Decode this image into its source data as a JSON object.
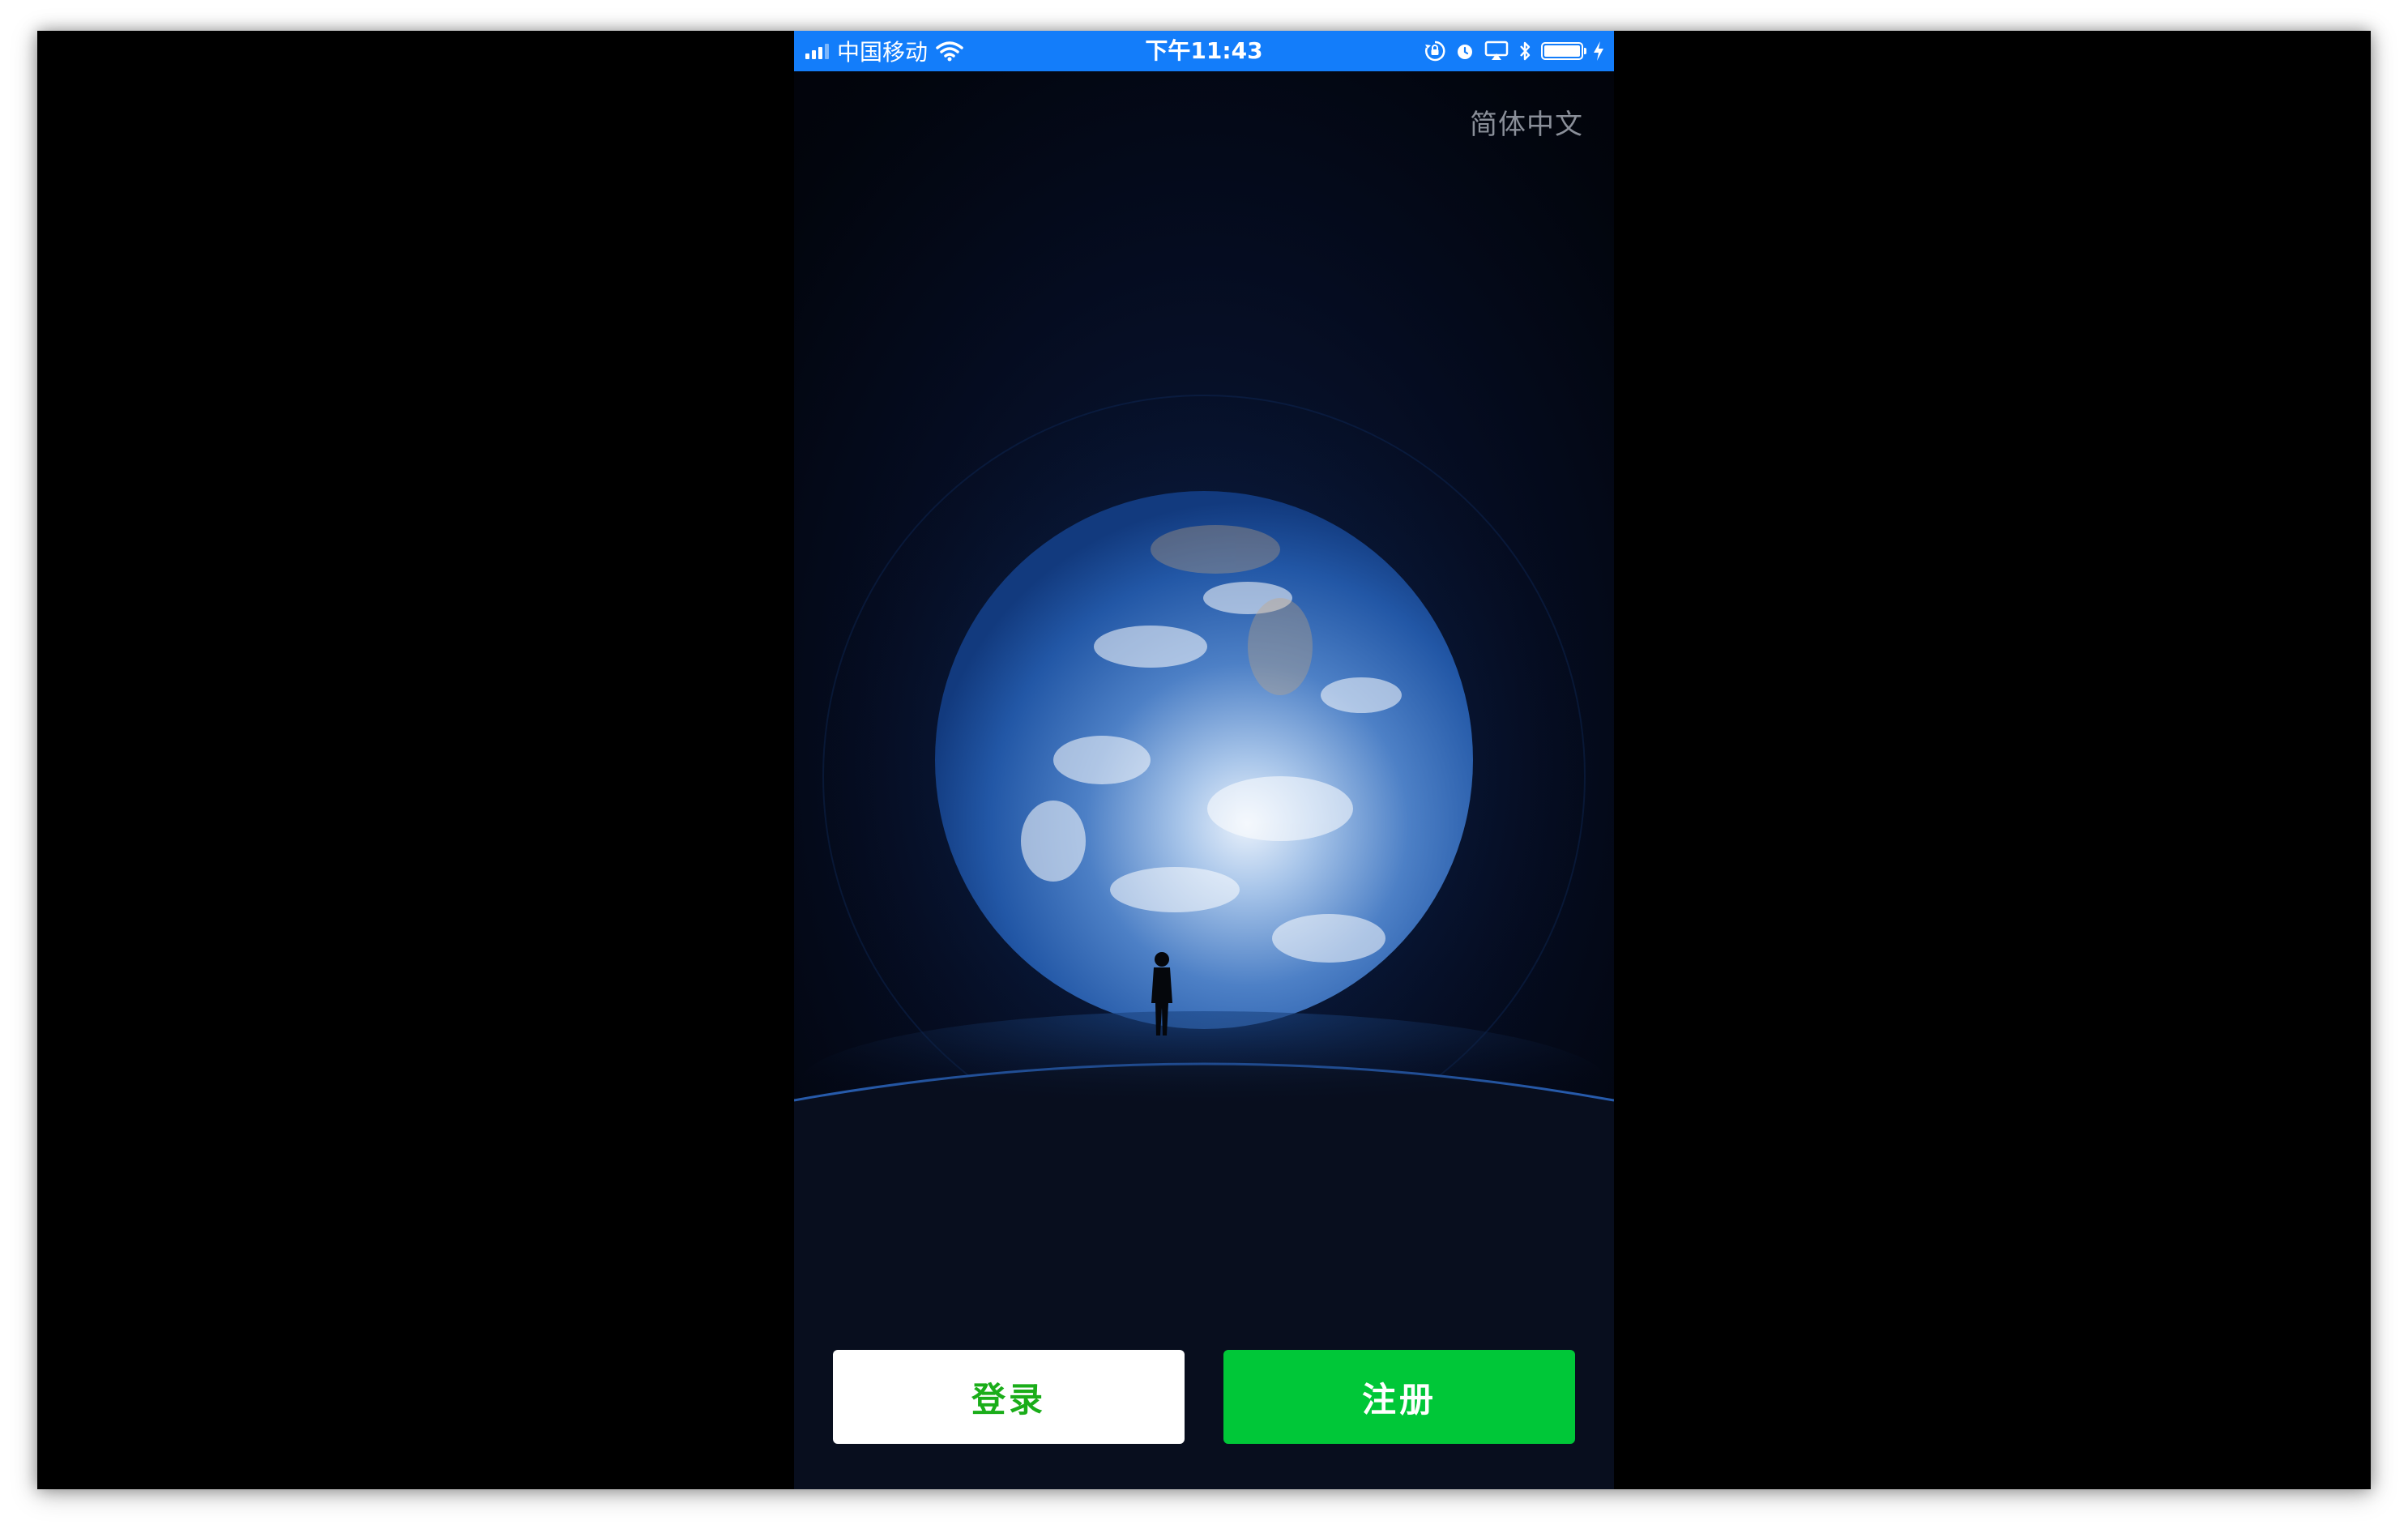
{
  "status_bar": {
    "carrier": "中国移动",
    "time": "下午11:43",
    "battery_level": 1.0,
    "background_color": "#137dfa",
    "icons": [
      "signal-icon",
      "wifi-icon",
      "rotation-lock-icon",
      "alarm-icon",
      "airplay-icon",
      "bluetooth-icon",
      "battery-icon",
      "charging-icon"
    ]
  },
  "language_selector": {
    "label": "简体中文"
  },
  "buttons": {
    "login_label": "登录",
    "register_label": "注册",
    "login_text_color": "#1aad19",
    "register_background": "#00c738"
  }
}
